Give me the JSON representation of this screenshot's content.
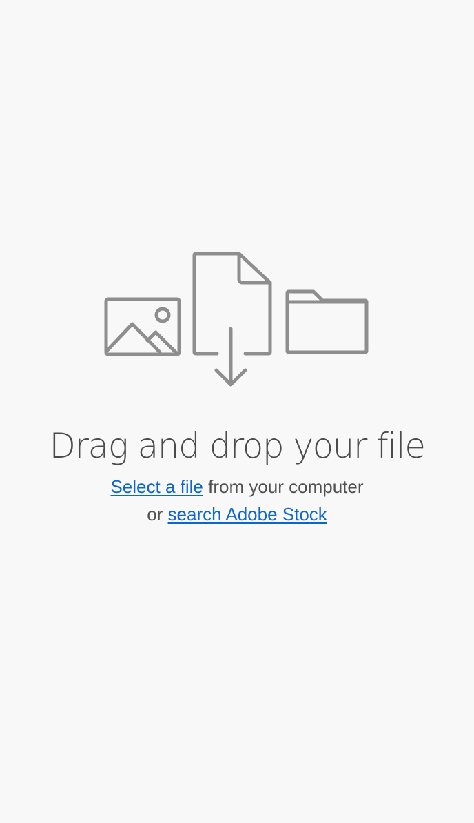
{
  "headline": "Drag and drop your file",
  "select_link": "Select a file",
  "select_suffix": " from your computer",
  "stock_prefix": "or ",
  "stock_link": "search Adobe Stock",
  "icons": [
    "image-icon",
    "file-download-icon",
    "folder-icon"
  ],
  "colors": {
    "background": "#f8f8f8",
    "icon_stroke": "#8e8e8e",
    "text": "#505050",
    "link": "#0d66d0"
  }
}
